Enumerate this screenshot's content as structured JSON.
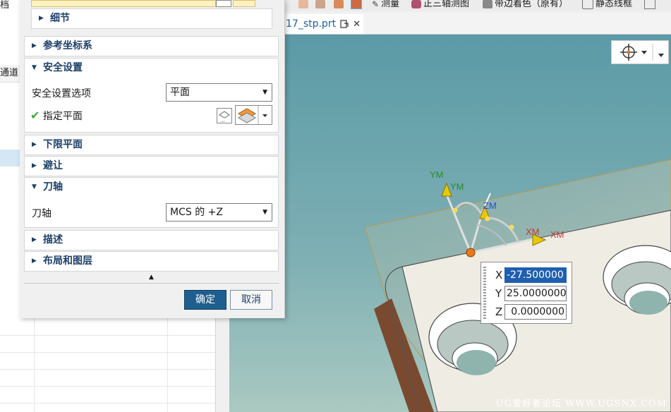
{
  "left_panel": {
    "top_fragment": "档",
    "column_fragment": "通道"
  },
  "toolbar": {
    "measure": "测量",
    "trimetric": "正三轴测图",
    "shaded_with_edges": "带边着色（原有）",
    "static_wireframe": "静态线框"
  },
  "document_tab": {
    "label": "17_stp.prt"
  },
  "dialog": {
    "sections": {
      "details": "细节",
      "reference_csys": "参考坐标系",
      "clearance": "安全设置",
      "lower_limit": "下限平面",
      "avoidance": "避让",
      "tool_axis": "刀轴",
      "description": "描述",
      "layout_layers": "布局和图层"
    },
    "clearance_option_label": "安全设置选项",
    "clearance_option_value": "平面",
    "specify_plane_label": "指定平面",
    "tool_axis_label": "刀轴",
    "tool_axis_value": "MCS 的 +Z",
    "ok_button": "确定",
    "cancel_button": "取消"
  },
  "graphics": {
    "handle_labels": {
      "ym_outer": "YM",
      "ym_inner": "YM",
      "zm": "ZM",
      "xm_inner": "XM",
      "xm_outer": "XM"
    },
    "coords": {
      "x_label": "X",
      "x_value": "-27.500000",
      "y_label": "Y",
      "y_value": "25.0000000",
      "z_label": "Z",
      "z_value": "0.0000000"
    }
  },
  "watermark": "UG爱好者论坛 WWW.UGSNX.COM",
  "colors": {
    "viewport_top": "#5a9aa6",
    "viewport_bottom": "#a8c8c0",
    "part_face": "#eeebe3",
    "part_side": "#7a4a30",
    "accent_blue": "#1d5fa8",
    "check_green": "#3aaa35",
    "handle_orange": "#e87a1a",
    "handle_yellow": "#e8c800"
  }
}
